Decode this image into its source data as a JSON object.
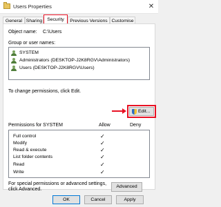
{
  "window": {
    "title": "Users Properties",
    "close_glyph": "✕"
  },
  "tabs": [
    {
      "label": "General",
      "active": false
    },
    {
      "label": "Sharing",
      "active": false
    },
    {
      "label": "Security",
      "active": true
    },
    {
      "label": "Previous Versions",
      "active": false
    },
    {
      "label": "Customise",
      "active": false
    }
  ],
  "security": {
    "object_name_label": "Object name:",
    "object_name_value": "C:\\Users",
    "group_label": "Group or user names:",
    "users": [
      {
        "name": "SYSTEM",
        "icon": "group-icon"
      },
      {
        "name": "Administrators (DESKTOP-J2K8RGV\\Administrators)",
        "icon": "group-icon"
      },
      {
        "name": "Users (DESKTOP-J2K8RGV\\Users)",
        "icon": "group-icon"
      }
    ],
    "change_permissions_text": "To change permissions, click Edit.",
    "edit_button_label": "Edit...",
    "permissions_for_label": "Permissions for SYSTEM",
    "allow_header": "Allow",
    "deny_header": "Deny",
    "permissions": [
      {
        "name": "Full control",
        "allow": "✓",
        "deny": ""
      },
      {
        "name": "Modify",
        "allow": "✓",
        "deny": ""
      },
      {
        "name": "Read & execute",
        "allow": "✓",
        "deny": ""
      },
      {
        "name": "List folder contents",
        "allow": "✓",
        "deny": ""
      },
      {
        "name": "Read",
        "allow": "✓",
        "deny": ""
      },
      {
        "name": "Write",
        "allow": "✓",
        "deny": ""
      }
    ],
    "special_text_line1": "For special permissions or advanced settings,",
    "special_text_line2": "click Advanced.",
    "advanced_button_label": "Advanced"
  },
  "footer": {
    "ok_label": "OK",
    "cancel_label": "Cancel",
    "apply_label": "Apply"
  },
  "colors": {
    "highlight": "#e81123",
    "window_bg": "#f0f0f0"
  }
}
